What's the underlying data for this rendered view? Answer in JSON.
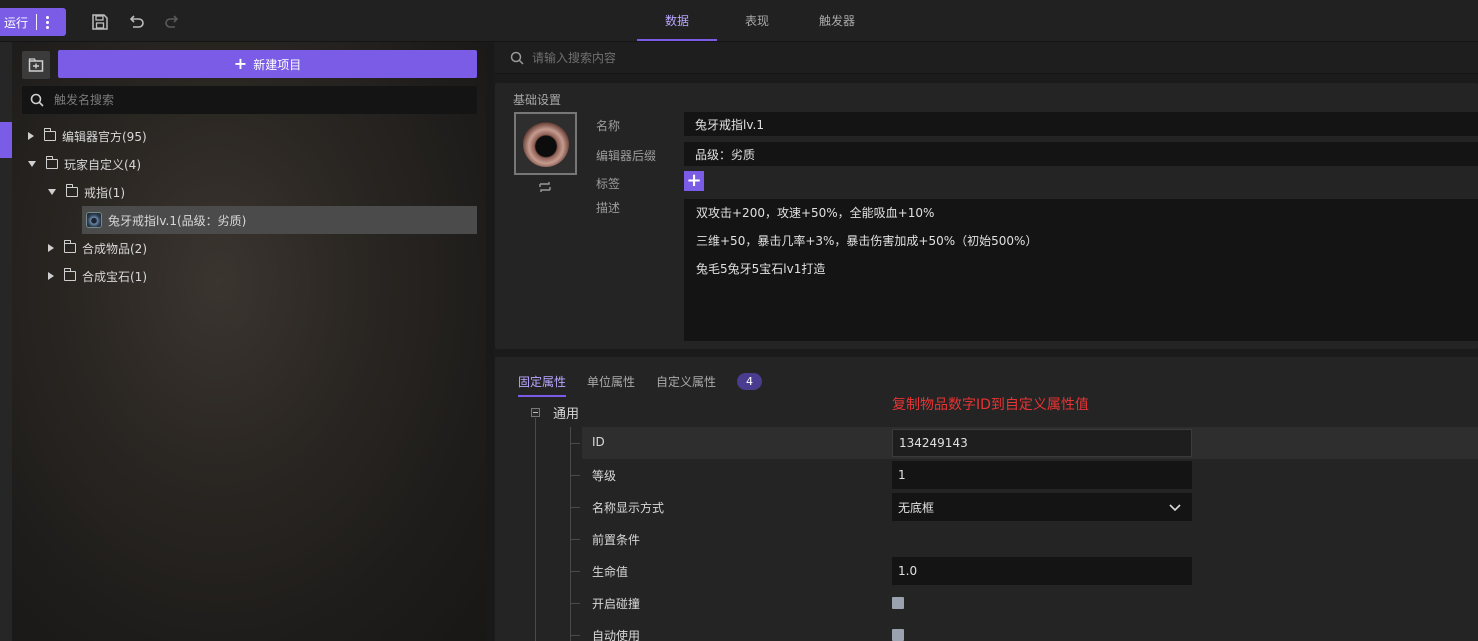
{
  "toolbar": {
    "run_label": "运行",
    "icons": [
      "save-icon",
      "undo-icon",
      "redo-icon",
      "more-icon"
    ]
  },
  "tabs": [
    {
      "label": "数据",
      "active": true
    },
    {
      "label": "表现",
      "active": false
    },
    {
      "label": "触发器",
      "active": false
    }
  ],
  "left_panel": {
    "new_item_label": "新建项目",
    "search_placeholder": "触发名搜索",
    "tree": [
      {
        "label": "编辑器官方(95)",
        "expanded": false,
        "level": 0
      },
      {
        "label": "玩家自定义(4)",
        "expanded": true,
        "level": 0
      },
      {
        "label": "戒指(1)",
        "expanded": true,
        "level": 1
      },
      {
        "label": "兔牙戒指lv.1(品级：劣质)",
        "selected": true,
        "level": 2
      },
      {
        "label": "合成物品(2)",
        "expanded": false,
        "level": 1
      },
      {
        "label": "合成宝石(1)",
        "expanded": false,
        "level": 1
      }
    ]
  },
  "right_panel": {
    "search_placeholder": "请输入搜索内容",
    "basic": {
      "title": "基础设置",
      "name_label": "名称",
      "name_value": "兔牙戒指lv.1",
      "suffix_label": "编辑器后缀",
      "suffix_value": "品级：劣质",
      "tag_label": "标签",
      "desc_label": "描述",
      "desc_lines": [
        "双攻击+200，攻速+50%，全能吸血+10%",
        "三维+50，暴击几率+3%，暴击伤害加成+50%（初始500%）",
        "兔毛5兔牙5宝石lv1打造"
      ]
    },
    "props": {
      "tabs": [
        {
          "label": "固定属性",
          "active": true
        },
        {
          "label": "单位属性",
          "active": false
        },
        {
          "label": "自定义属性",
          "active": false
        }
      ],
      "badge": "4",
      "hint": "复制物品数字ID到自定义属性值",
      "group_label": "通用",
      "rows": [
        {
          "label": "ID",
          "value": "134249143"
        },
        {
          "label": "等级",
          "value": "1"
        },
        {
          "label": "名称显示方式",
          "value": "无底框"
        },
        {
          "label": "前置条件",
          "value": ""
        },
        {
          "label": "生命值",
          "value": "1.0"
        },
        {
          "label": "开启碰撞",
          "checked": true
        },
        {
          "label": "自动使用",
          "checked": true
        }
      ]
    }
  },
  "colors": {
    "accent": "#7b5ce6",
    "hint": "#e53434",
    "panel": "#242424",
    "field": "#141414"
  }
}
